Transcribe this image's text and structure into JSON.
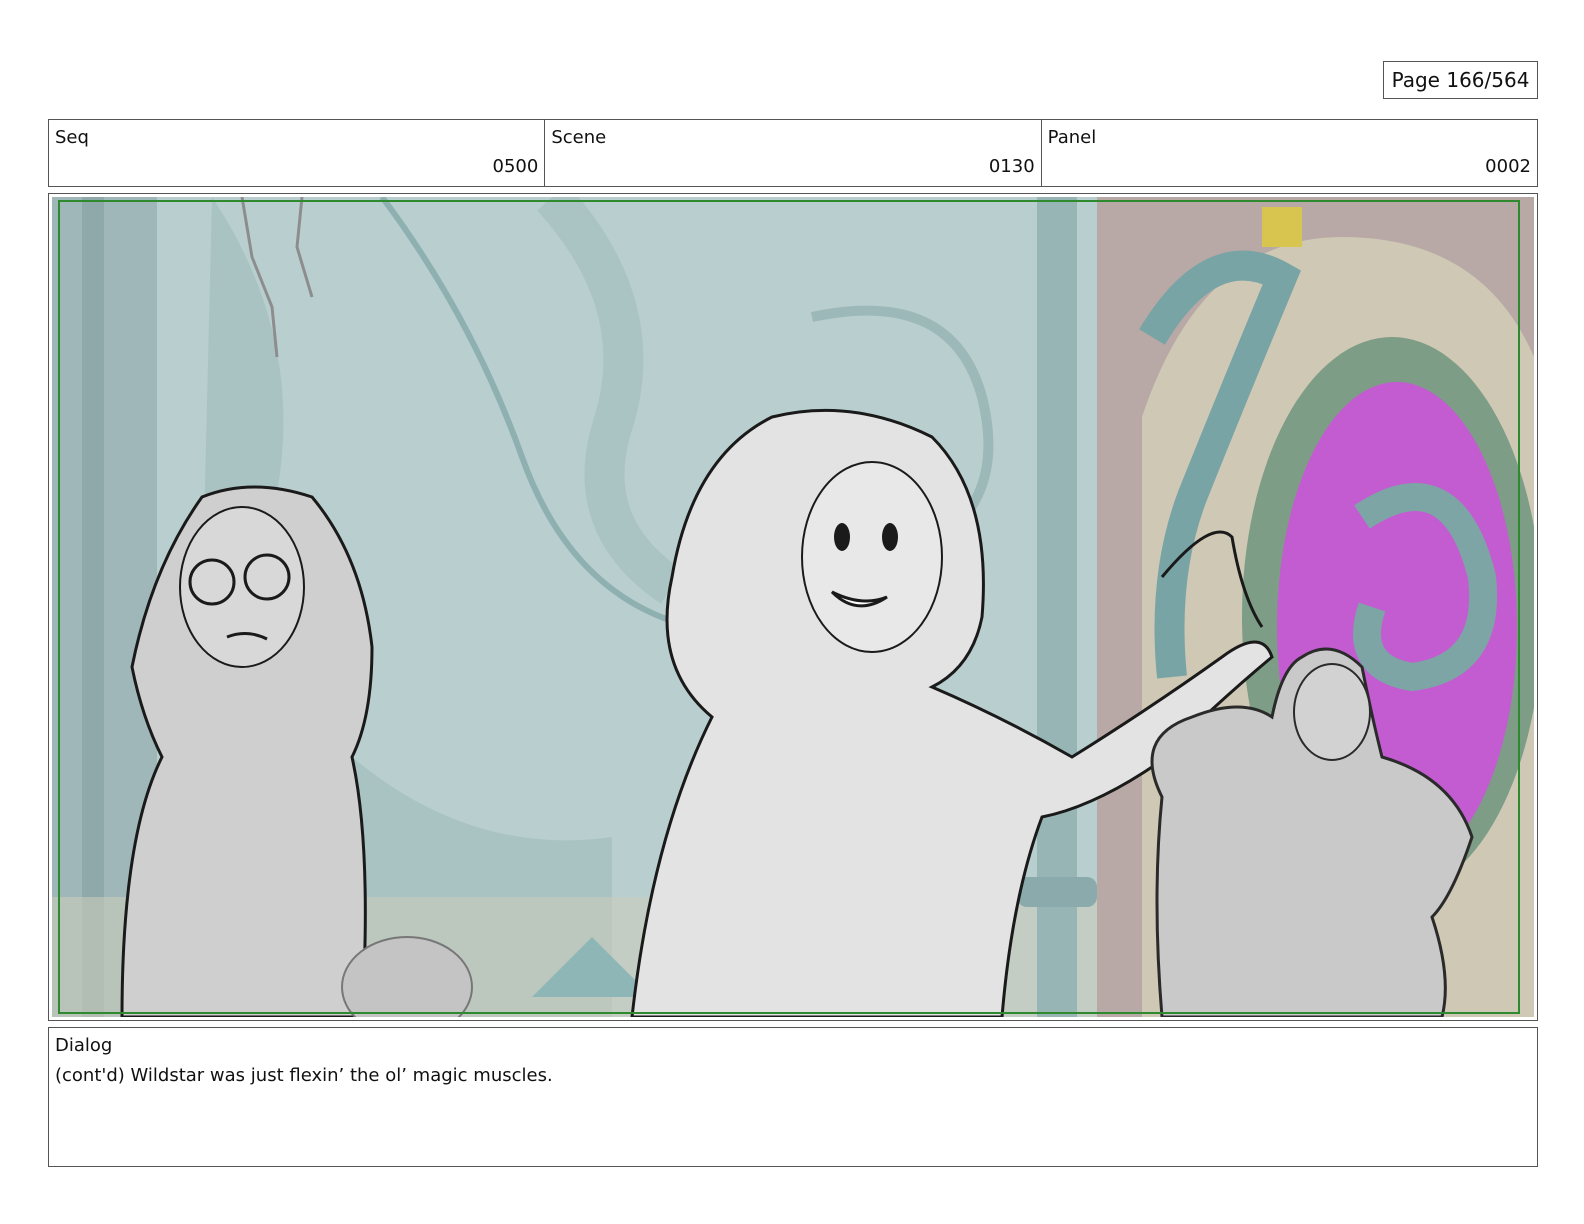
{
  "page": {
    "label": "Page 166/564"
  },
  "header": {
    "seq": {
      "label": "Seq",
      "value": "0500"
    },
    "scene": {
      "label": "Scene",
      "value": "0130"
    },
    "panel": {
      "label": "Panel",
      "value": "0002"
    }
  },
  "artwork": {
    "description_icon": "storyboard-sketch-icon",
    "safe_frame_color": "#2f8a2f",
    "background_color": "#b7cdcc",
    "portal_color": "#c45ad0"
  },
  "dialog": {
    "label": "Dialog",
    "text": "(cont'd) Wildstar was just flexin’ the ol’ magic muscles."
  }
}
